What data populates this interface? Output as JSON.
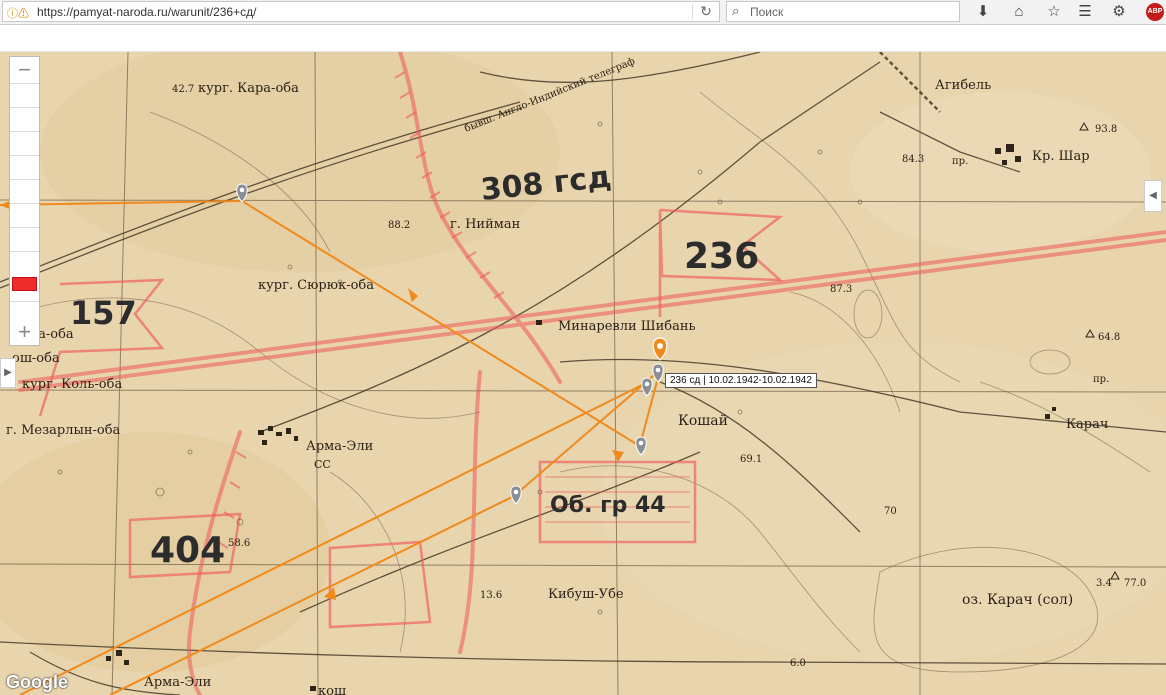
{
  "browser": {
    "url": "https://pamyat-naroda.ru/warunit/236+сд/",
    "search_placeholder": "Поиск",
    "abp_label": "ABP"
  },
  "map": {
    "tooltip": "236 сд | 10.02.1942-10.02.1942",
    "google_logo": "Google",
    "zoom_in_label": "+",
    "zoom_out_label": "−",
    "labels": {
      "kurg_kara_oba": "кург. Кара-оба",
      "elev_42_7": "42.7",
      "telegraph": "бывш. Англо-Индийский телеграф",
      "agibel": "Агибель",
      "elev_93_8": "93.8",
      "kr_shar": "Кр. Шар",
      "elev_84_3": "84.3",
      "pr1": "пр.",
      "pr2": "пр.",
      "elev_88_2": "88.2",
      "g_niyman": "г. Нийман",
      "kurg_syuryuk_oba": "кург. Сюрюк-оба",
      "minarevli_shiban": "Минаревли Шибань",
      "elev_87_3": "87.3",
      "elev_64_8": "64.8",
      "kara_oba": "Кара-оба",
      "kosh_oba": "ош-оба",
      "kurg_kol_oba": "кург. Коль-оба",
      "g_mezarlyn_oba": "г. Мезарлын-оба",
      "arma_eli_top": "Арма-Эли",
      "ss": "СС",
      "koshay": "Кошай",
      "elev_69_1": "69.1",
      "karach": "Карач",
      "elev_58_6": "58.6",
      "elev_70": "70",
      "kibush_ube": "Кибуш-Убе",
      "elev_13_6": "13.6",
      "oz_karach": "оз. Карач (сол)",
      "elev_3_4": "3.4",
      "elev_77_0": "77.0",
      "arma_eli_bottom": "Арма-Эли",
      "kosh_bottom": "кош",
      "elev_6_0": "6.0"
    },
    "annotations": {
      "unit_308": "308 гсд",
      "unit_236": "236",
      "unit_157": "157",
      "unit_404": "404",
      "unit_ob_gr": "Об. гр 44"
    },
    "colors": {
      "route": "#f08a1c",
      "marker": "#8a8f96",
      "active_marker": "#f08a1c",
      "red_pencil": "#ef5a5a"
    }
  }
}
